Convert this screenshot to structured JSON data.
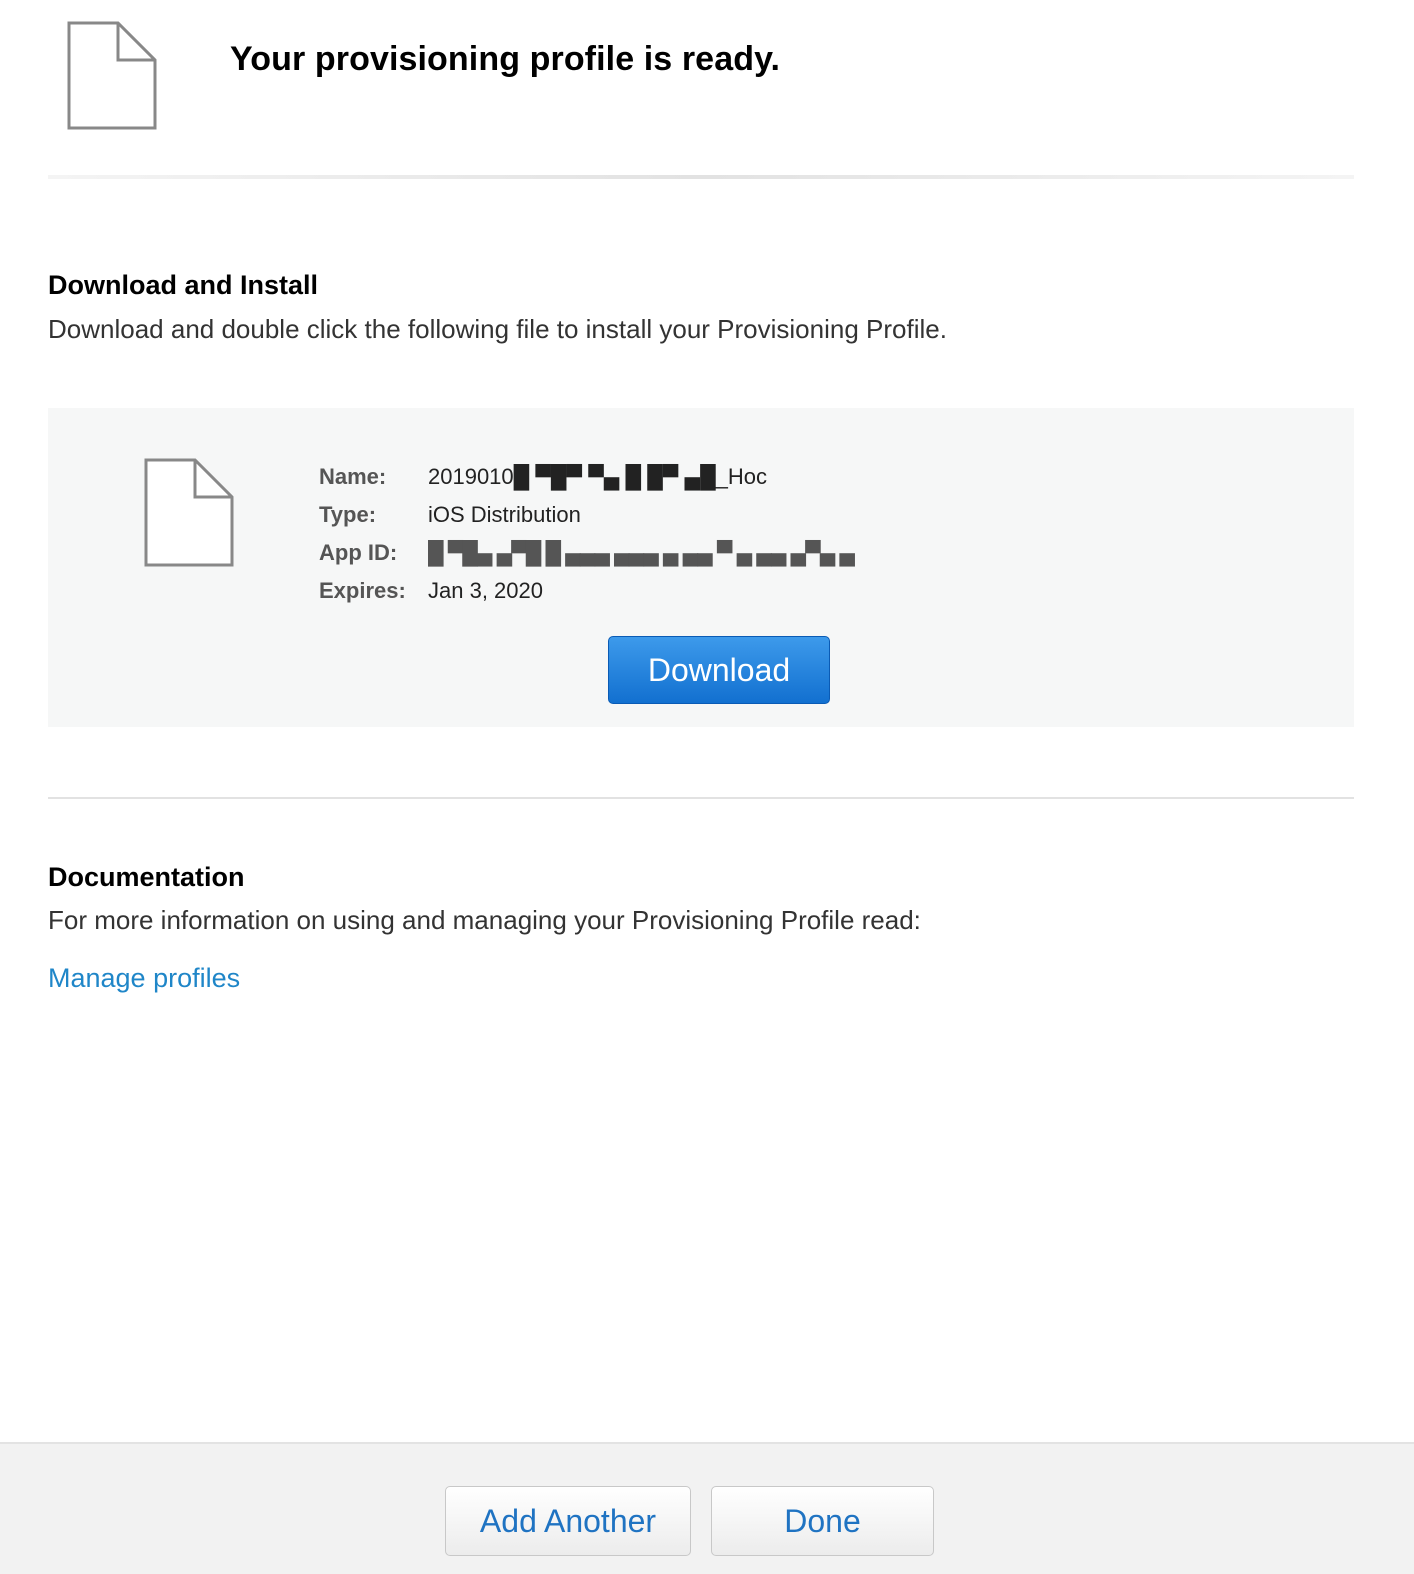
{
  "header": {
    "icon": "document-icon",
    "title": "Your provisioning profile is ready."
  },
  "download_section": {
    "heading": "Download and Install",
    "description": "Download and double click the following file to install your Provisioning Profile."
  },
  "profile": {
    "icon": "document-icon",
    "name_label": "Name:",
    "name_value": "2019010█ ▀█▀ ▀▄ █ █▀  ▄█_Hoc",
    "type_label": "Type:",
    "type_value": "iOS Distribution",
    "appid_label": "App ID:",
    "appid_value": "█ ▀█▄ ▄▀█ █ ▄▄▄ ▄▄▄ ▄ ▄▄ ▀ ▄ ▄▄ ▄▀▄ ▄",
    "expires_label": "Expires:",
    "expires_value": "Jan 3, 2020",
    "download_label": "Download"
  },
  "documentation": {
    "heading": "Documentation",
    "description": "For more information on using and managing your Provisioning Profile read:",
    "link_label": "Manage profiles"
  },
  "footer": {
    "add_another_label": "Add Another",
    "done_label": "Done"
  },
  "colors": {
    "link": "#1f86c8",
    "primary_button": "#1270d0",
    "footer_button_text": "#1f73c2",
    "panel_background": "#f6f7f7"
  }
}
